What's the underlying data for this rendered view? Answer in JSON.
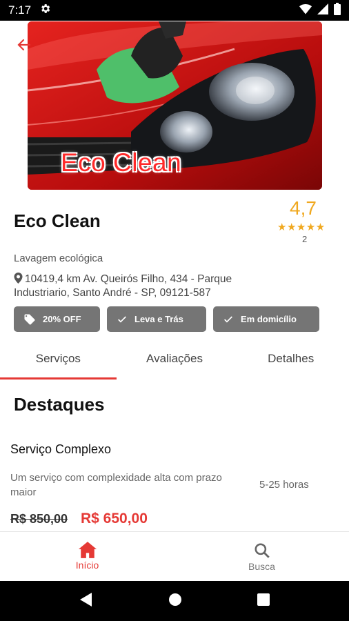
{
  "status_bar": {
    "time": "7:17"
  },
  "hero": {
    "overlay_text": "Eco Clean"
  },
  "store": {
    "name": "Eco Clean",
    "rating": "4,7",
    "stars": "★★★★★",
    "review_count": "2",
    "category": "Lavagem ecológica",
    "address": "10419,4 km Av. Queirós Filho, 434 - Parque Industriario, Santo André - SP, 09121-587"
  },
  "badges": [
    {
      "label": "20% OFF",
      "icon": "tag-icon"
    },
    {
      "label": "Leva e Trás",
      "icon": "check-icon"
    },
    {
      "label": "Em domicílio",
      "icon": "check-icon"
    }
  ],
  "tabs": [
    {
      "label": "Serviços",
      "active": true
    },
    {
      "label": "Avaliações",
      "active": false
    },
    {
      "label": "Detalhes",
      "active": false
    }
  ],
  "highlights": {
    "title": "Destaques",
    "service": {
      "name": "Serviço Complexo",
      "description": "Um serviço com complexidade alta com prazo maior",
      "duration": "5-25 horas",
      "old_price": "R$ 850,00",
      "new_price": "R$ 650,00"
    }
  },
  "bottom_nav": [
    {
      "label": "Início",
      "icon": "home-icon",
      "active": true
    },
    {
      "label": "Busca",
      "icon": "search-icon",
      "active": false
    }
  ],
  "colors": {
    "accent": "#e53935",
    "rating": "#f0a81f",
    "badge_bg": "#757575"
  }
}
